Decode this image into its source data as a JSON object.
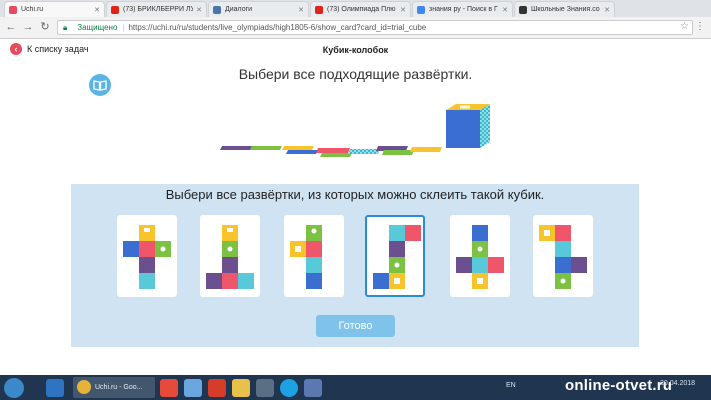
{
  "browser": {
    "tabs": [
      {
        "title": "Uchi.ru",
        "active": true,
        "favicon_color": "#e54a5f"
      },
      {
        "title": "(73) БРИКЛБЕРРИ ЛУЧ",
        "active": false,
        "favicon_color": "#e62117"
      },
      {
        "title": "Диалоги",
        "active": false,
        "favicon_color": "#4a76a8"
      },
      {
        "title": "(73) Олимпиада Плю",
        "active": false,
        "favicon_color": "#e62117"
      },
      {
        "title": "знания ру - Поиск в Г",
        "active": false,
        "favicon_color": "#4285f4"
      },
      {
        "title": "Школьные Знания.co",
        "active": false,
        "favicon_color": "#333333"
      }
    ],
    "secure_label": "Защищено",
    "url": "https://uchi.ru/ru/students/live_olympiads/high1805-6/show_card?card_id=trial_cube"
  },
  "page": {
    "back_label": "К списку задач",
    "title": "Кубик-колобок",
    "instruction": "Выбери все подходящие развёртки.",
    "question": "Выбери все развёртки, из которых можно склеить такой кубик.",
    "done_label": "Готово",
    "options": [
      {
        "id": 1,
        "selected": false
      },
      {
        "id": 2,
        "selected": false
      },
      {
        "id": 3,
        "selected": false
      },
      {
        "id": 4,
        "selected": true
      },
      {
        "id": 5,
        "selected": false
      },
      {
        "id": 6,
        "selected": false
      }
    ]
  },
  "taskbar": {
    "app_label": "Uchi.ru - Goo...",
    "lang": "EN",
    "time": "",
    "date": "20.04.2018"
  },
  "watermark": "online-otvet.ru",
  "colors": {
    "yellow": "#f7c52b",
    "red": "#f0566a",
    "green": "#7cc242",
    "blue": "#3a6fd1",
    "purple": "#6b4f8f",
    "cyan": "#57c9d8",
    "panel": "#cfe3f2",
    "accent": "#2a8bd6"
  }
}
